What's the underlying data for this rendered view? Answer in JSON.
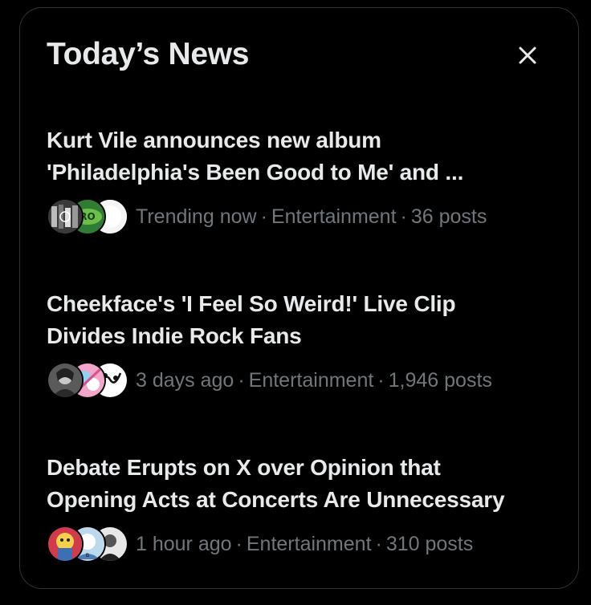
{
  "widget": {
    "title": "Today’s News",
    "close_icon": "close-icon"
  },
  "stories": [
    {
      "headline_line1": "Kurt Vile announces new album",
      "headline_line2": "'Philadelphia's Been Good to Me' and ...",
      "status": "Trending now",
      "category": "Entertainment",
      "posts": "36 posts",
      "avatars": [
        "avatar-kurt-vile-band-photo",
        "avatar-green-logo",
        "avatar-white-circle"
      ]
    },
    {
      "headline_line1": "Cheekface's 'I Feel So Weird!' Live Clip",
      "headline_line2": "Divides Indie Rock Fans",
      "status": "3 days ago",
      "category": "Entertainment",
      "posts": "1,946 posts",
      "avatars": [
        "avatar-portrait",
        "avatar-pink-illustration",
        "avatar-black-white-drawing"
      ]
    },
    {
      "headline_line1": "Debate Erupts on X over Opinion that",
      "headline_line2": "Opening Acts at Concerts Are Unnecessary",
      "status": "1 hour ago",
      "category": "Entertainment",
      "posts": "310 posts",
      "avatars": [
        "avatar-cartoon-character",
        "avatar-blue-illustration",
        "avatar-bw-portrait"
      ]
    }
  ],
  "separator": "·",
  "colors": {
    "background": "#000000",
    "primary_text": "#e7e9ea",
    "secondary_text": "#71767b",
    "border": "#2f3336"
  }
}
